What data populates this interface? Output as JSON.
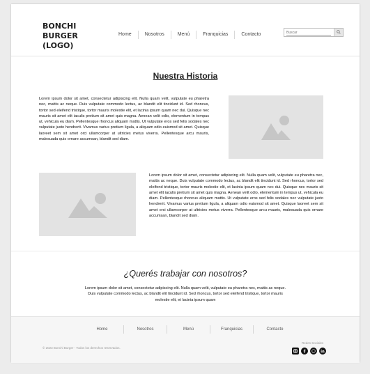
{
  "header": {
    "logo_lines": [
      "BONCHI",
      "BURGER",
      "(LOGO)"
    ],
    "nav": [
      "Home",
      "Nosotros",
      "Menú",
      "Franquicias",
      "Contacto"
    ],
    "search_placeholder": "Buscar"
  },
  "historia": {
    "title": "Nuestra Historia",
    "paragraph_1": "Lorem ipsum dolor sit amet, consectetur adipiscing elit. Nulla quam velit, vulputate eu pharetra nec, mattis ac neque. Duis vulputate commodo lectus, ac blandit elit tincidunt id. Sed rhoncus, tortor sed eleifend tristique, tortor mauris molestie elit, et lacinia ipsum quam nec dui. Quisque nec mauris sit amet elit iaculis pretium sit amet quis magna. Aenean velit odio, elementum in tempus ut, vehicula eu diam. Pellentesque rhoncus aliquam mattis. Ut vulputate eros sed felis sodales nec vulputate justo hendrerit. Vivamus varius pretium ligula, a aliquam odio euismod sit amet. Quisque laoreet sem sit amet orci ullamcorper at ultricies metus viverra. Pellentesque arcu mauris, malesuada quis ornare accumsan, blandit sed diam.",
    "paragraph_2": "Lorem ipsum dolor sit amet, consectetur adipiscing elit. Nulla quam velit, vulputate eu pharetra nec, mattis ac neque. Duis vulputate commodo lectus, ac blandit elit tincidunt id. Sed rhoncus, tortor sed eleifend tristique, tortor mauris molestie elit, et lacinia ipsum quam nec dui. Quisque nec mauris sit amet elit iaculis pretium sit amet quis magna. Aenean velit odio, elementum in tempus ut, vehicula eu diam. Pellentesque rhoncus aliquam mattis. Ut vulputate eros sed felis sodales nec vulputate justo hendrerit. Vivamus varius pretium ligula, a aliquam odio euismod sit amet. Quisque laoreet sem sit amet orci ullamcorper at ultricies metus viverra. Pellentesque arcu mauris, malesuada quis ornare accumsan, blandit sed diam."
  },
  "trabaja": {
    "title": "¿Querés trabajar con nosotros?",
    "text": "Lorem ipsum dolor sit amet, consectetur adipiscing elit. Nulla quam velit, vulputate eu pharetra nec, mattis ac neque. Duis vulputate commodo lectus, ac blandit elit tincidunt id. Sed rhoncus, tortor sed eleifend tristique, tortor mauris molestie elit, et lacinia ipsum quam"
  },
  "footer": {
    "nav": [
      "Home",
      "Nosotros",
      "Menú",
      "Franquicias",
      "Contacto"
    ],
    "copyright": "© 2023 Bonchi Burger - Todos los derechos reservados.",
    "social_label": "Redes Sociales",
    "social_icons": [
      "instagram-icon",
      "facebook-icon",
      "whatsapp-icon",
      "linkedin-icon"
    ]
  }
}
